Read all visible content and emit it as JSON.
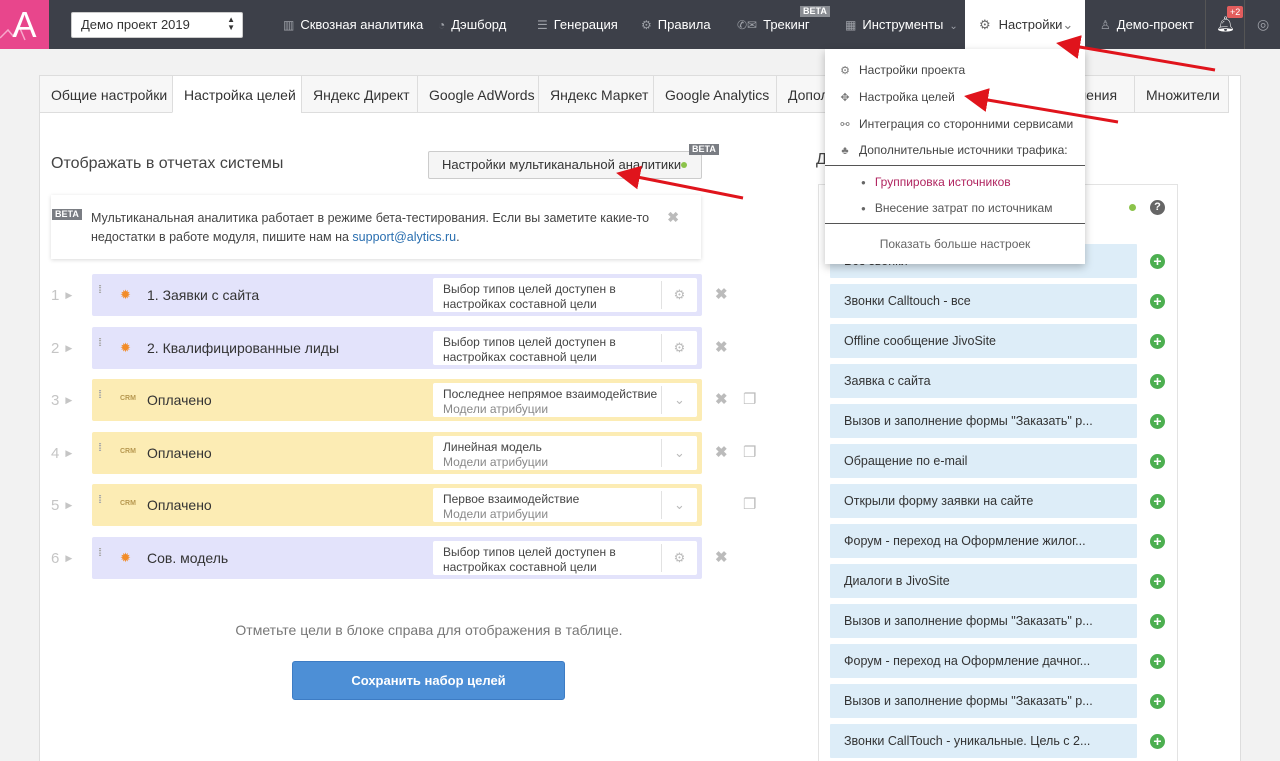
{
  "nav": {
    "logo_letter": "A",
    "project": "Демо проект 2019",
    "items": [
      {
        "label": "Сквозная аналитика",
        "icon": "chart-bars-icon"
      },
      {
        "label": "Дэшборд",
        "icon": "dashboard-icon"
      },
      {
        "label": "Генерация",
        "icon": "list-icon"
      },
      {
        "label": "Правила",
        "icon": "gears-icon"
      },
      {
        "label": "Трекинг",
        "icon": "phone-mail-icon",
        "badge": "BETA"
      },
      {
        "label": "Инструменты",
        "icon": "grid-icon"
      },
      {
        "label": "Настройки",
        "icon": "gear-icon"
      },
      {
        "label": "Демо-проект",
        "icon": "user-icon"
      }
    ],
    "notifications_badge": "+2"
  },
  "tabs": [
    "Общие настройки",
    "Настройка целей",
    "Яндекс Директ",
    "Google AdWords",
    "Яндекс Маркет",
    "Google Analytics",
    "Допол",
    "ления",
    "Множители"
  ],
  "active_tab": "Настройка целей",
  "section_title": "Отображать в отчетах системы",
  "multichannel_button": "Настройки мультиканальной аналитики",
  "beta_label": "BETA",
  "notice": {
    "text": "Мультиканальная аналитика работает в режиме бета-тестирования. Если вы заметите какие-то недостатки в работе модуля, пишите нам на ",
    "link": "support@alytics.ru",
    "tail": "."
  },
  "goals": [
    {
      "num": "1",
      "name": "1. Заявки с сайта",
      "type": "composite",
      "line1": "Выбор типов целей доступен в",
      "line2": "настройках составной цели"
    },
    {
      "num": "2",
      "name": "2. Квалифицированные лиды",
      "type": "composite",
      "line1": "Выбор типов целей доступен в",
      "line2": "настройках составной цели"
    },
    {
      "num": "3",
      "name": "Оплачено",
      "type": "crm",
      "line1": "Последнее непрямое взаимодействие",
      "line2": "Модели атрибуции"
    },
    {
      "num": "4",
      "name": "Оплачено",
      "type": "crm",
      "line1": "Линейная модель",
      "line2": "Модели атрибуции"
    },
    {
      "num": "5",
      "name": "Оплачено",
      "type": "crm",
      "line1": "Первое взаимодействие",
      "line2": "Модели атрибуции"
    },
    {
      "num": "6",
      "name": "Сов. модель",
      "type": "composite",
      "line1": "Выбор типов целей доступен в",
      "line2": "настройках составной цели"
    }
  ],
  "crm_label": "CRM",
  "hint": "Отметьте цели в блоке справа для отображения в таблице.",
  "save_button": "Сохранить набор целей",
  "right_title": "Д",
  "available_goals": [
    "Все звонки",
    "Звонки Calltouch - все",
    "Offline сообщение JivoSite",
    "Заявка с сайта",
    "Вызов и заполнение формы \"Заказать\" р...",
    "Обращение по e-mail",
    "Открыли форму заявки на сайте",
    "Форум - переход на Оформление жилог...",
    "Диалоги в JivoSite",
    "Вызов и заполнение формы \"Заказать\" р...",
    "Форум - переход на Оформление дачног...",
    "Вызов и заполнение формы \"Заказать\" р...",
    "Звонки CallTouch - уникальные. Цель с 2..."
  ],
  "dropdown": {
    "items": [
      {
        "label": "Настройки проекта",
        "icon": "gear-icon"
      },
      {
        "label": "Настройка целей",
        "icon": "target-icon"
      },
      {
        "label": "Интеграция со сторонними сервисами",
        "icon": "handshake-icon"
      },
      {
        "label": "Дополнительные источники трафика:",
        "icon": "sitemap-icon"
      }
    ],
    "subitems": [
      "Группировка источников",
      "Внесение затрат по источникам"
    ],
    "more": "Показать больше настроек"
  },
  "colors": {
    "topbar": "#3d4049",
    "logo": "#e8468c",
    "violet_card": "#e3e3fb",
    "yellow_card": "#fcecb4",
    "goal_chip": "#ddedf8",
    "save": "#4d8fd6",
    "plus": "#4caf50",
    "arrow": "#e0141c",
    "active_sub": "#b0245f"
  }
}
